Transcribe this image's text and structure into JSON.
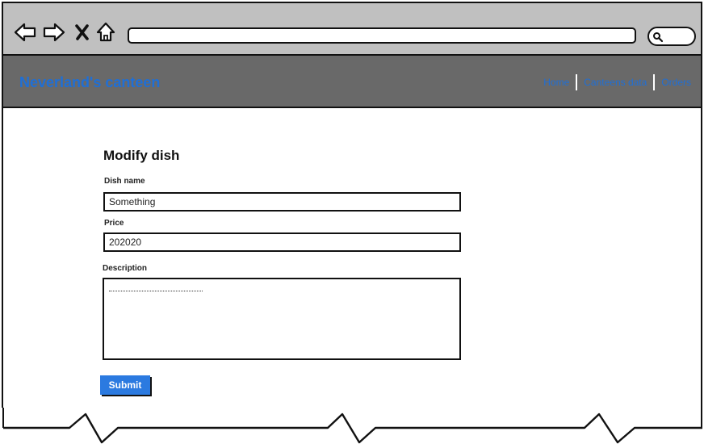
{
  "browser": {
    "back_icon": "arrow-left-icon",
    "forward_icon": "arrow-right-icon",
    "stop_icon": "close-icon",
    "home_icon": "home-icon",
    "search_icon": "search-icon",
    "url": ""
  },
  "header": {
    "brand": "Neverland's canteen",
    "nav": [
      {
        "label": "Home"
      },
      {
        "label": "Canteens data"
      },
      {
        "label": "Orders"
      }
    ],
    "brand_color": "#1f6fd6",
    "background_color": "#696969"
  },
  "form": {
    "title": "Modify dish",
    "dish_name": {
      "label": "Dish name",
      "value": "Something"
    },
    "price": {
      "label": "Price",
      "value": "202020"
    },
    "description": {
      "label": "Description",
      "value": ""
    },
    "submit_label": "Submit",
    "submit_color": "#2b7ae0"
  }
}
